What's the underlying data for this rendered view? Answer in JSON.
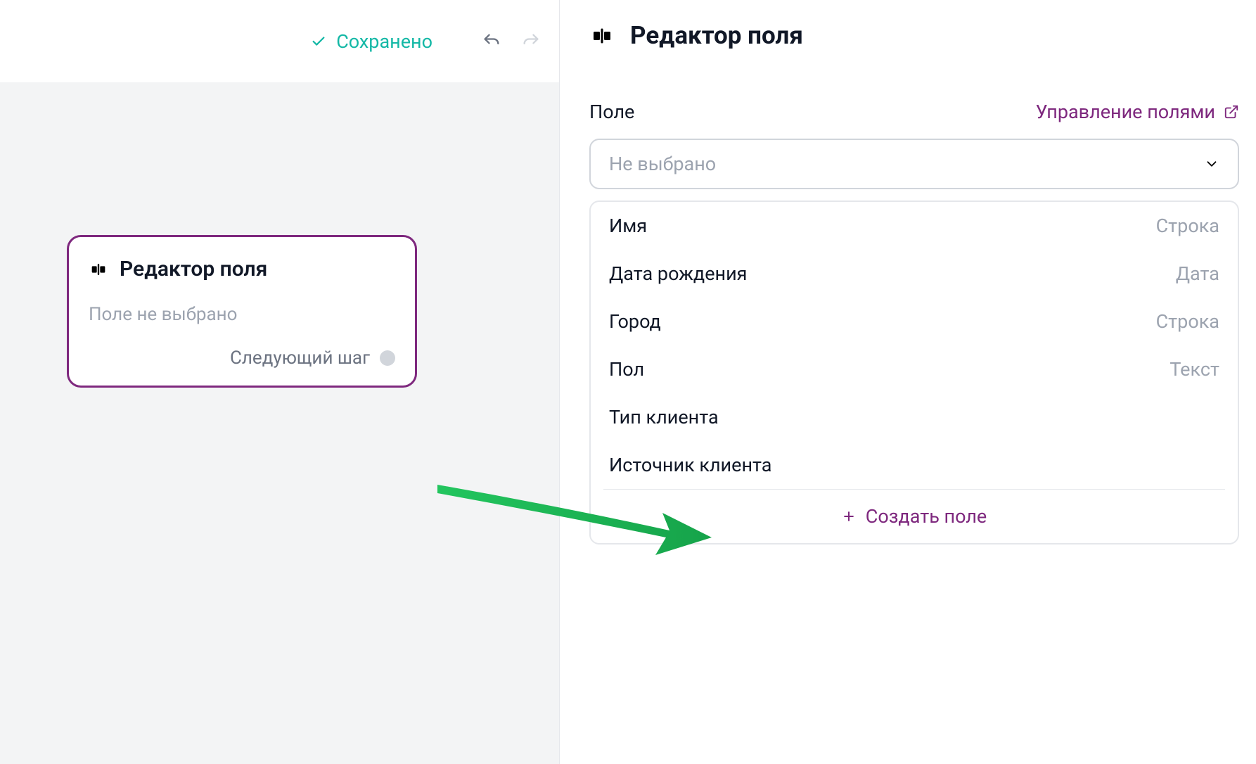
{
  "topbar": {
    "saved_status": "Сохранено"
  },
  "card": {
    "title": "Редактор поля",
    "subtitle": "Поле не выбрано",
    "next_step": "Следующий шаг"
  },
  "editor": {
    "title": "Редактор поля",
    "field_label": "Поле",
    "manage_fields": "Управление полями",
    "select_placeholder": "Не выбрано",
    "create_field": "Создать поле",
    "options": [
      {
        "name": "Имя",
        "type": "Строка"
      },
      {
        "name": "Дата рождения",
        "type": "Дата"
      },
      {
        "name": "Город",
        "type": "Строка"
      },
      {
        "name": "Пол",
        "type": "Текст"
      },
      {
        "name": "Тип клиента",
        "type": ""
      },
      {
        "name": "Источник клиента",
        "type": ""
      }
    ]
  }
}
